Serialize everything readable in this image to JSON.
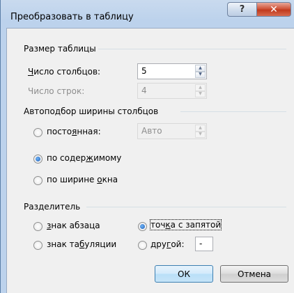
{
  "window": {
    "title": "Преобразовать в таблицу",
    "help_label": "?",
    "close_label": "✕"
  },
  "table_size": {
    "label": "Размер таблицы",
    "columns": {
      "label_pre": "",
      "label_ul": "Ч",
      "label_post": "исло столбцов:",
      "value": "5"
    },
    "rows": {
      "label": "Число строк:",
      "value": "4"
    }
  },
  "autofit": {
    "label": "Автоподбор ширины столбцов",
    "fixed": {
      "pre": "посто",
      "ul": "я",
      "post": "нная:",
      "value": "Авто"
    },
    "contents": {
      "pre": "по содер",
      "ul": "ж",
      "post": "имому"
    },
    "window": {
      "pre": "по ширине ",
      "ul": "о",
      "post": "кна"
    },
    "selected": "contents"
  },
  "separator": {
    "label": "Разделитель",
    "paragraph": {
      "pre": "",
      "ul": "з",
      "post": "нак абзаца"
    },
    "tab": {
      "pre": "знак та",
      "ul": "б",
      "post": "уляции"
    },
    "semicolon": {
      "pre": "точ",
      "ul": "к",
      "post": "а с запятой"
    },
    "other": {
      "pre": "дру",
      "ul": "г",
      "post": "ой:",
      "value": "-"
    },
    "selected": "semicolon"
  },
  "buttons": {
    "ok": "ОК",
    "cancel": "Отмена"
  }
}
